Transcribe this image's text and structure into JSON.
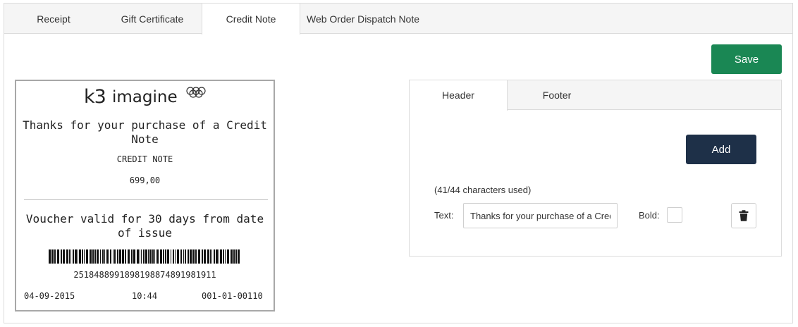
{
  "tabs": [
    "Receipt",
    "Gift Certificate",
    "Credit Note",
    "Web Order Dispatch Note"
  ],
  "active_tab": "Credit Note",
  "save_label": "Save",
  "receipt": {
    "logo_k3": "k3",
    "logo_imagine": "imagine",
    "header_text": "Thanks for your purchase of a Credit Note",
    "title": "CREDIT NOTE",
    "amount": "699,00",
    "footer_text": "Voucher valid for 30 days from date of issue",
    "barcode_number": "2518488991898198874891981911",
    "date": "04-09-2015",
    "time": "10:44",
    "reference": "001-01-00110"
  },
  "editor": {
    "tabs": [
      "Header",
      "Footer"
    ],
    "active_tab": "Header",
    "add_label": "Add",
    "chars_used": "(41/44 characters used)",
    "text_label": "Text:",
    "text_value": "Thanks for your purchase of a Credit Note",
    "bold_label": "Bold:",
    "bold_checked": false,
    "delete_icon": "trash-icon"
  },
  "colors": {
    "save_button": "#1a8754",
    "add_button": "#1e3048"
  }
}
